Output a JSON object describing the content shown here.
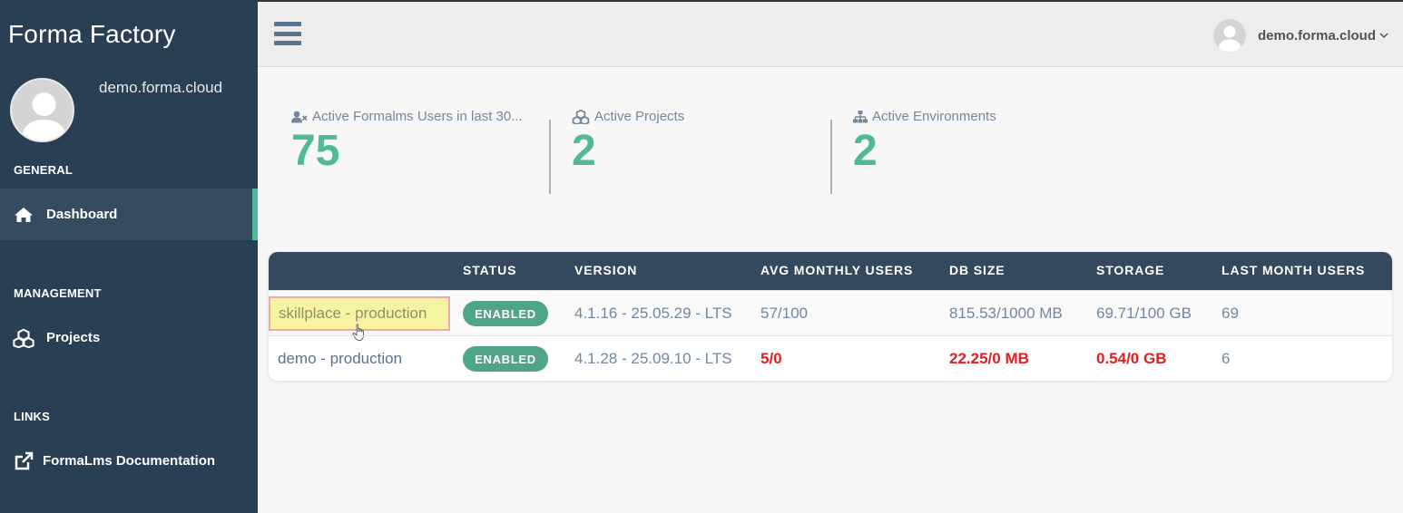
{
  "app": {
    "title": "Forma Factory"
  },
  "sidebar": {
    "profile_name": "demo.forma.cloud",
    "sections": [
      {
        "title": "GENERAL",
        "items": [
          {
            "label": "Dashboard",
            "icon": "home-icon",
            "active": true
          }
        ]
      },
      {
        "title": "MANAGEMENT",
        "items": [
          {
            "label": "Projects",
            "icon": "cubes-icon"
          }
        ]
      },
      {
        "title": "LINKS",
        "items": [
          {
            "label": "FormaLms Documentation",
            "icon": "external-link-icon"
          }
        ]
      }
    ]
  },
  "topbar": {
    "user_name": "demo.forma.cloud"
  },
  "stats": [
    {
      "label": "Active Formalms Users in last 30...",
      "value": "75",
      "icon": "user-times-icon"
    },
    {
      "label": "Active Projects",
      "value": "2",
      "icon": "cubes-icon"
    },
    {
      "label": "Active Environments",
      "value": "2",
      "icon": "sitemap-icon"
    }
  ],
  "table": {
    "columns": [
      "",
      "STATUS",
      "VERSION",
      "AVG MONTHLY USERS",
      "DB SIZE",
      "STORAGE",
      "LAST MONTH USERS"
    ],
    "rows": [
      {
        "name": "skillplace - production",
        "status": "ENABLED",
        "version": "4.1.16 - 25.05.29 - LTS",
        "avg_monthly_users": "57/100",
        "db_size": "815.53/1000 MB",
        "storage": "69.71/100 GB",
        "last_month_users": "69"
      },
      {
        "name": "demo - production",
        "status": "ENABLED",
        "version": "4.1.28 - 25.09.10 - LTS",
        "avg_monthly_users": "5/0",
        "db_size": "22.25/0 MB",
        "storage": "0.54/0 GB",
        "last_month_users": "6"
      }
    ]
  },
  "colors": {
    "sidebar_bg": "#2a3f54",
    "accent_green": "#4fb999",
    "badge_green": "#4fa58a",
    "warning_red": "#e02020",
    "table_header": "#34495e"
  }
}
